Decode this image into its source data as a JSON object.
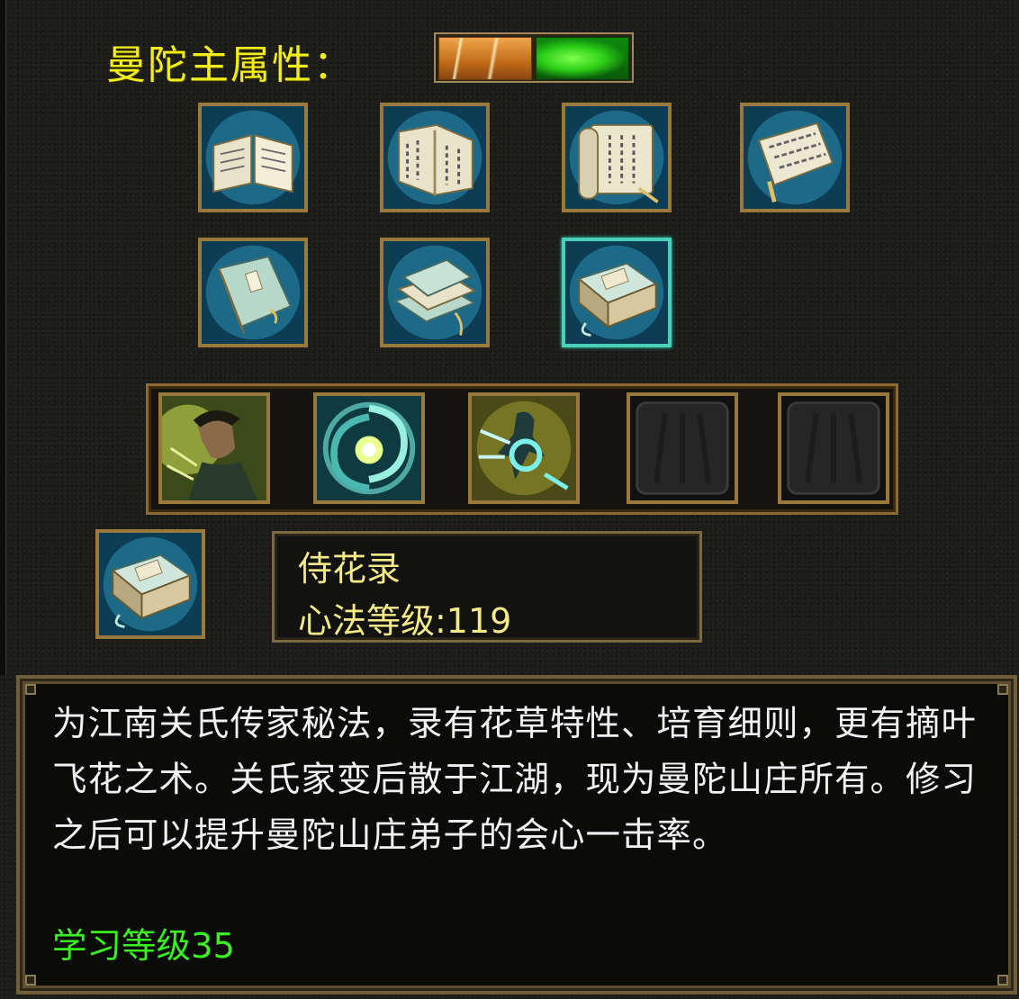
{
  "attributes": {
    "label": "曼陀主属性：",
    "segments": [
      {
        "name": "gold-attribute-icon",
        "color": "#d98a2a"
      },
      {
        "name": "green-attribute-icon",
        "color": "#2ecf18"
      }
    ]
  },
  "manuals": [
    {
      "name": "open-book-icon"
    },
    {
      "name": "bound-book-icon"
    },
    {
      "name": "scroll-book-icon"
    },
    {
      "name": "scroll-icon"
    },
    {
      "name": "closed-book-icon"
    },
    {
      "name": "book-stack-icon"
    },
    {
      "name": "book-box-icon",
      "selected": true
    }
  ],
  "skills": [
    {
      "name": "warrior-skill-icon",
      "empty": false
    },
    {
      "name": "vortex-skill-icon",
      "empty": false
    },
    {
      "name": "spin-strike-skill-icon",
      "empty": false
    },
    {
      "name": "empty-skill-slot-icon",
      "empty": true
    },
    {
      "name": "empty-skill-slot-icon",
      "empty": true
    }
  ],
  "selected": {
    "icon": "book-box-icon",
    "name": "侍花录",
    "level_label": "心法等级",
    "level": "119",
    "level_text": "心法等级:119"
  },
  "description": {
    "text": "为江南关氏传家秘法，录有花草特性、培育细则，更有摘叶飞花之术。关氏家变后散于江湖，现为曼陀山庄所有。修习之后可以提升曼陀山庄弟子的会心一击率。",
    "requirement": "学习等级35",
    "text_color": "#f2f2f2",
    "requirement_color": "#3aef22"
  },
  "colors": {
    "label": "#f2ee1e",
    "frame": "#9a7a3c",
    "selected_frame": "#4ad0b8"
  }
}
